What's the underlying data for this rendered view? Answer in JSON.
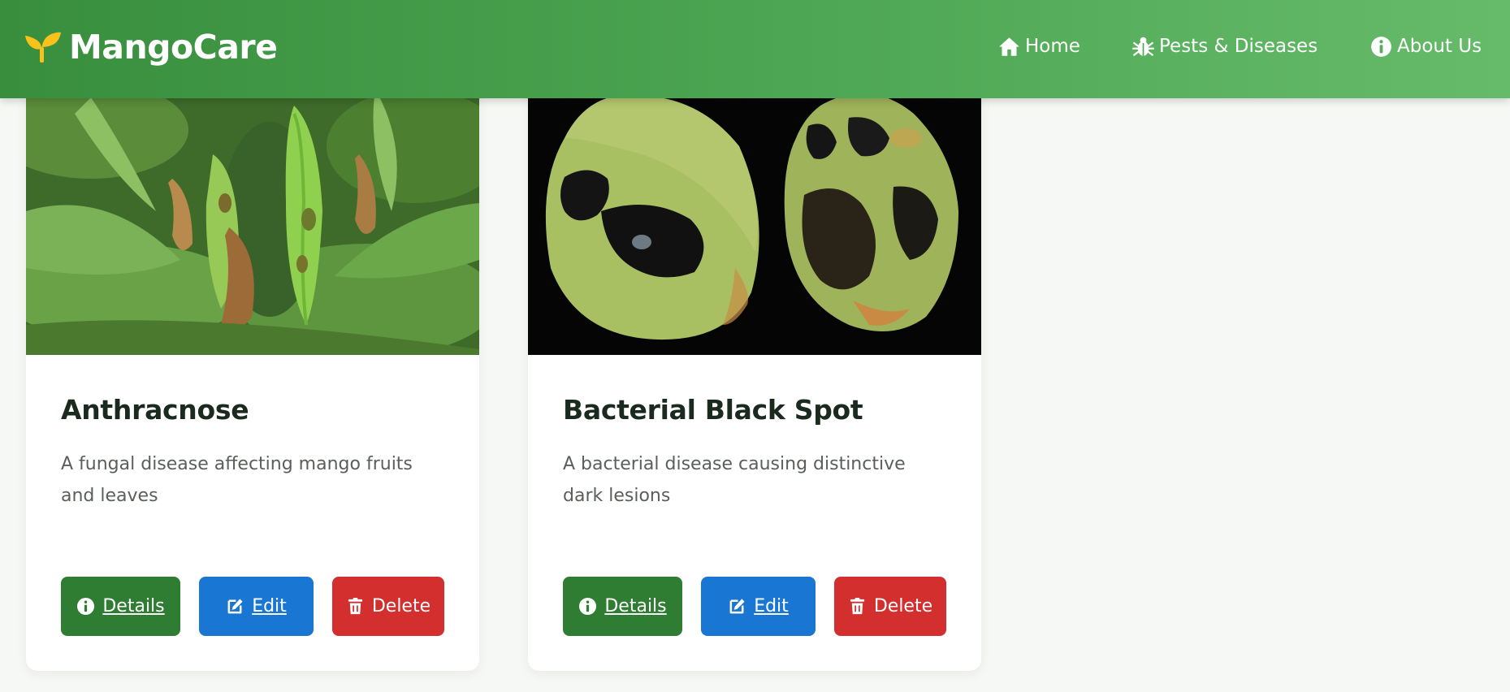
{
  "app": {
    "brand": "MangoCare",
    "colors": {
      "primary": "#388e3c",
      "details": "#2e7d32",
      "edit": "#1976d2",
      "delete": "#d32f2f"
    }
  },
  "nav": {
    "items": [
      {
        "label": "Home",
        "icon": "home-icon"
      },
      {
        "label": "Pests & Diseases",
        "icon": "bug-icon"
      },
      {
        "label": "About Us",
        "icon": "info-icon"
      }
    ]
  },
  "cards": [
    {
      "title": "Anthracnose",
      "description": "A fungal disease affecting mango fruits and leaves",
      "image": "photo of infected green pods among leaves",
      "buttons": {
        "details": "Details",
        "edit": "Edit",
        "delete": "Delete"
      }
    },
    {
      "title": "Bacterial Black Spot",
      "description": "A bacterial disease causing distinctive dark lesions",
      "image": "photo of two mangoes with black lesions",
      "buttons": {
        "details": "Details",
        "edit": "Edit",
        "delete": "Delete"
      }
    }
  ]
}
